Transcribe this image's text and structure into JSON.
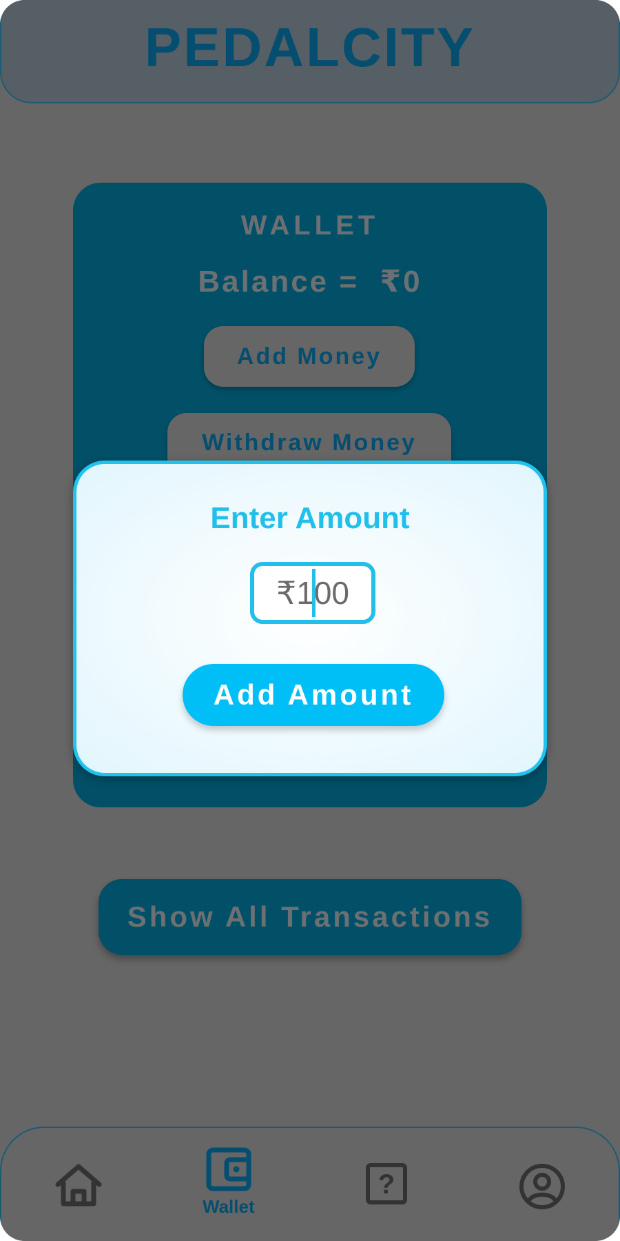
{
  "app": {
    "title": "PEDALCITY"
  },
  "wallet": {
    "label": "WALLET",
    "balance_text": "Balance =  ₹0",
    "add_money_label": "Add Money",
    "withdraw_money_label": "Withdraw Money"
  },
  "modal": {
    "title": "Enter Amount",
    "amount_value": "₹100",
    "add_amount_label": "Add Amount"
  },
  "transactions": {
    "label": "Show All Transactions"
  },
  "nav": {
    "items": [
      {
        "icon": "home-icon",
        "label": ""
      },
      {
        "icon": "wallet-icon",
        "label": "Wallet",
        "active": true
      },
      {
        "icon": "help-icon",
        "label": ""
      },
      {
        "icon": "profile-icon",
        "label": ""
      }
    ]
  },
  "colors": {
    "brand_dark": "#064e70",
    "accent_cyan": "#22bfeb",
    "button_cyan": "#00bff6",
    "overlay_gray": "#666666"
  }
}
